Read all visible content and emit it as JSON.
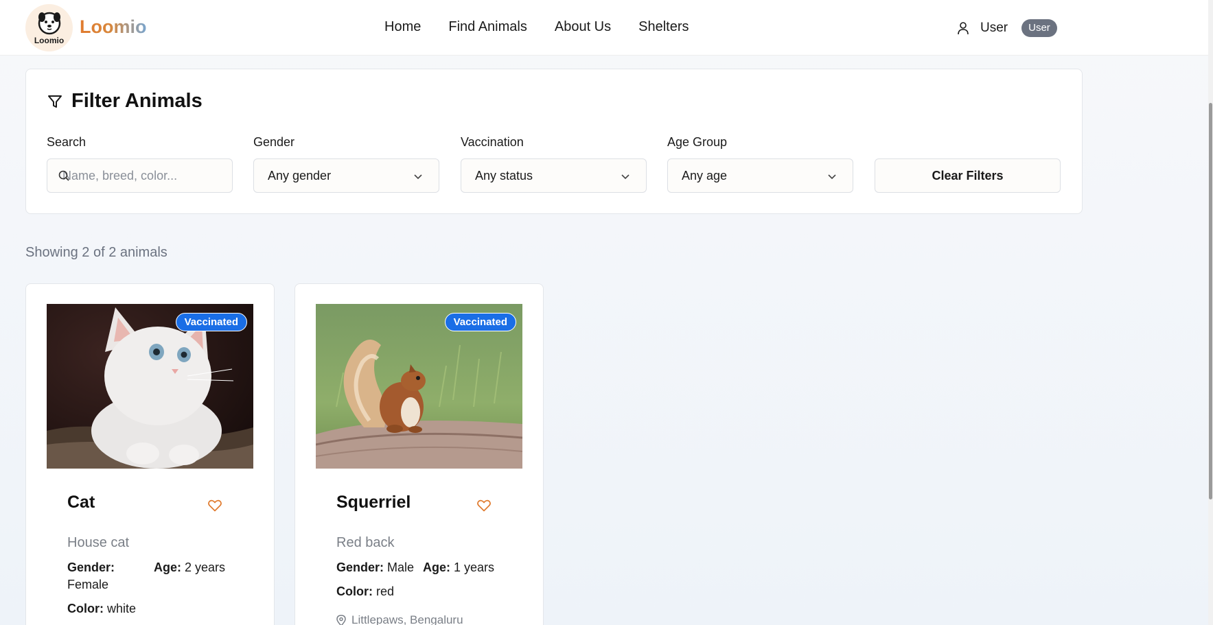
{
  "brand": {
    "name": "Loomio",
    "logo_text": "Loomio"
  },
  "nav": {
    "items": [
      "Home",
      "Find Animals",
      "About Us",
      "Shelters"
    ]
  },
  "user": {
    "name": "User",
    "role": "User"
  },
  "filter": {
    "title": "Filter Animals",
    "search_label": "Search",
    "search_placeholder": "Name, breed, color...",
    "gender_label": "Gender",
    "gender_value": "Any gender",
    "vaccination_label": "Vaccination",
    "vaccination_value": "Any status",
    "age_label": "Age Group",
    "age_value": "Any age",
    "clear_label": "Clear Filters"
  },
  "results": {
    "showing_text": "Showing 2 of 2 animals"
  },
  "animals": [
    {
      "name": "Cat",
      "breed": "House cat",
      "badge": "Vaccinated",
      "gender_label": "Gender:",
      "gender": "Female",
      "age_label": "Age:",
      "age": "2 years",
      "color_label": "Color:",
      "color": "white",
      "location": ""
    },
    {
      "name": "Squerriel",
      "breed": "Red back",
      "badge": "Vaccinated",
      "gender_label": "Gender:",
      "gender": "Male",
      "age_label": "Age:",
      "age": "1 years",
      "color_label": "Color:",
      "color": "red",
      "location": "Littlepaws, Bengaluru"
    }
  ],
  "colors": {
    "accent_orange": "#e07b2f",
    "badge_blue": "#1a6ee6",
    "role_badge": "#6b7280"
  },
  "icons": [
    "user-icon",
    "filter-icon",
    "search-icon",
    "chevron-down-icon",
    "heart-icon",
    "map-pin-icon"
  ]
}
